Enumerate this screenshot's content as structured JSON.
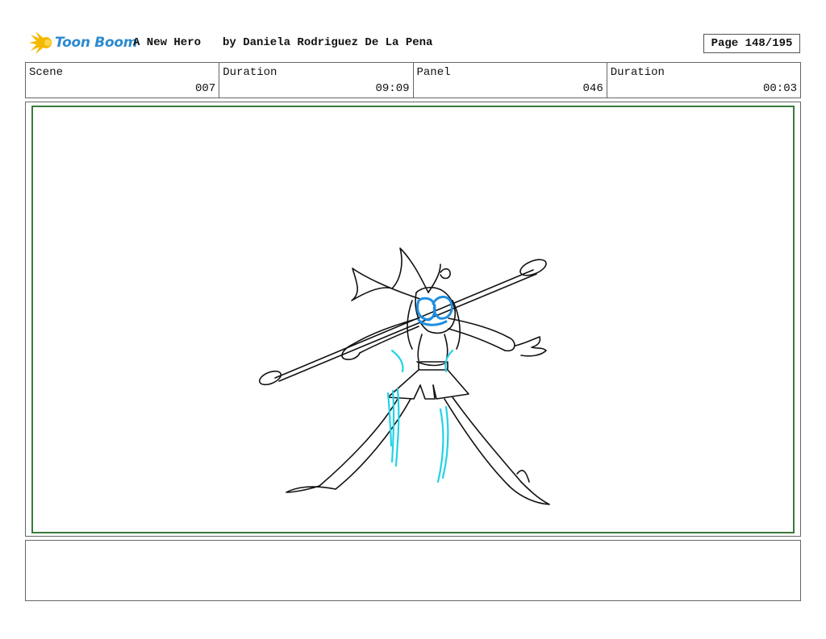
{
  "header": {
    "logo_text": "Toon Boom",
    "project_title": "A New Hero",
    "author": "by Daniela Rodriguez De La Pena",
    "page_label": "Page 148/195"
  },
  "info": [
    {
      "label": "Scene",
      "value": "007"
    },
    {
      "label": "Duration",
      "value": "09:09"
    },
    {
      "label": "Panel",
      "value": "046"
    },
    {
      "label": "Duration",
      "value": "00:03"
    }
  ],
  "colors": {
    "panel_border": "#3b7a3b",
    "logo_blue": "#2c8ad0",
    "logo_yellow": "#f5b800",
    "sketch_cyan": "#22d3e6",
    "mask_blue": "#1f8fe0"
  },
  "panel": {
    "illustration": "sketch-character-with-staff"
  },
  "notes": {
    "text": ""
  }
}
